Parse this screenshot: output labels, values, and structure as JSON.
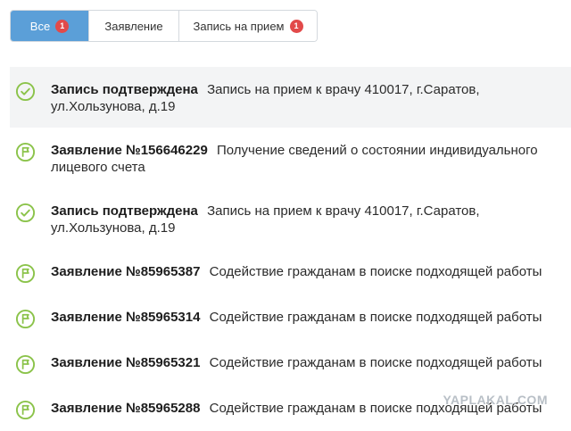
{
  "tabs": [
    {
      "label": "Все",
      "badge": "1",
      "active": true
    },
    {
      "label": "Заявление",
      "active": false
    },
    {
      "label": "Запись на прием",
      "badge": "1",
      "active": false
    }
  ],
  "items": [
    {
      "icon": "check-circle-icon",
      "title": "Запись подтверждена",
      "desc": "Запись на прием к врачу 410017, г.Саратов, ул.Хользунова, д.19",
      "highlighted": true
    },
    {
      "icon": "flag-circle-icon",
      "title": "Заявление №156646229",
      "desc": "Получение сведений о состоянии индивидуального лицевого счета"
    },
    {
      "icon": "check-circle-icon",
      "title": "Запись подтверждена",
      "desc": "Запись на прием к врачу 410017, г.Саратов, ул.Хользунова, д.19"
    },
    {
      "icon": "flag-circle-icon",
      "title": "Заявление №85965387",
      "desc": "Содействие гражданам в поиске подходящей работы"
    },
    {
      "icon": "flag-circle-icon",
      "title": "Заявление №85965314",
      "desc": "Содействие гражданам в поиске подходящей работы"
    },
    {
      "icon": "flag-circle-icon",
      "title": "Заявление №85965321",
      "desc": "Содействие гражданам в поиске подходящей работы"
    },
    {
      "icon": "flag-circle-icon",
      "title": "Заявление №85965288",
      "desc": "Содействие гражданам в поиске подходящей работы"
    }
  ],
  "watermark": "YAPLAKAL.COM",
  "colors": {
    "accent": "#5b9fd8",
    "badge": "#e24a4a",
    "icon": "#8bc34a",
    "highlight": "#f3f4f5"
  }
}
